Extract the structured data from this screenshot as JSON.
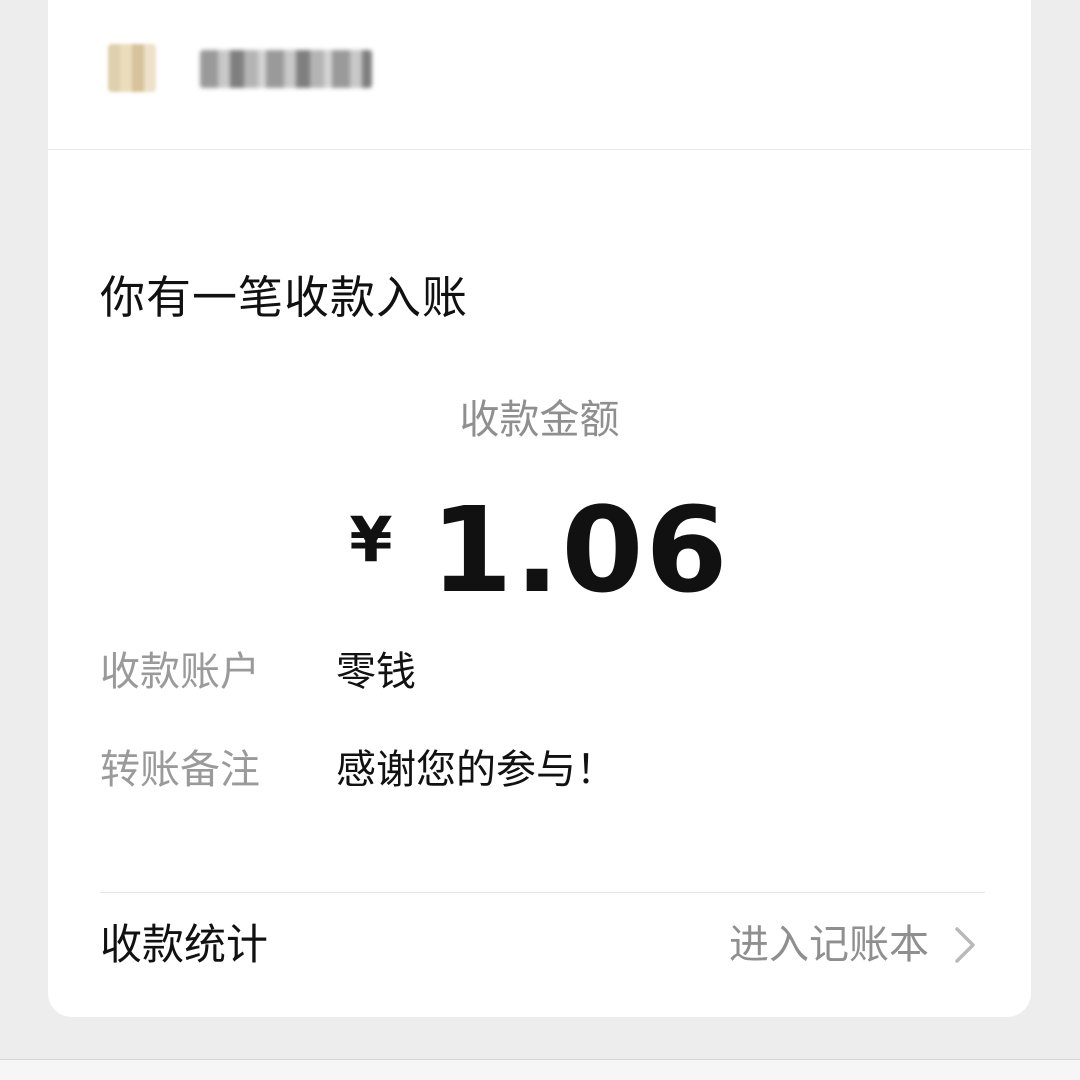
{
  "header": {
    "avatar_icon": "merchant-avatar",
    "account_name": ""
  },
  "notice": {
    "title": "你有一笔收款入账"
  },
  "amount": {
    "label": "收款金额",
    "currency": "¥",
    "value": "1.06"
  },
  "details": [
    {
      "label": "收款账户",
      "value": "零钱"
    },
    {
      "label": "转账备注",
      "value": "感谢您的参与！"
    }
  ],
  "stats": {
    "label": "收款统计",
    "link": "进入记账本",
    "chevron_icon": "chevron-right-icon"
  },
  "colors": {
    "background": "#ededed",
    "card": "#ffffff",
    "primary_text": "#111111",
    "secondary_text": "#8f8f8f"
  }
}
